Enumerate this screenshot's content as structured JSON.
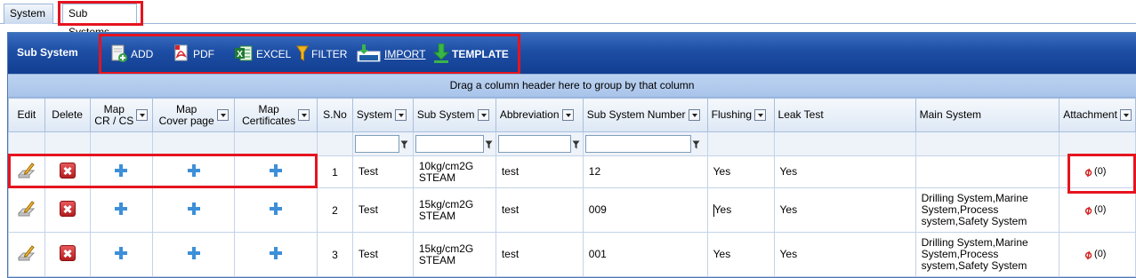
{
  "tabs": [
    {
      "label": "System",
      "active": false
    },
    {
      "label": "Sub Systems",
      "active": true
    }
  ],
  "toolbar": {
    "title": "Sub System",
    "add": "ADD",
    "pdf": "PDF",
    "excel": "EXCEL",
    "filter": "FILTER",
    "import": "IMPORT",
    "template": "TEMPLATE"
  },
  "group_hint": "Drag a column header here to group by that column",
  "columns": {
    "edit": "Edit",
    "delete": "Delete",
    "map_cr_1": "Map",
    "map_cr_2": "CR / CS",
    "map_cover_1": "Map",
    "map_cover_2": "Cover page",
    "map_cert_1": "Map",
    "map_cert_2": "Certificates",
    "sno": "S.No",
    "system": "System",
    "sub_system": "Sub System",
    "abbreviation": "Abbreviation",
    "sub_system_number": "Sub System Number",
    "flushing": "Flushing",
    "leak_test": "Leak Test",
    "main_system": "Main System",
    "attachment": "Attachment"
  },
  "rows": [
    {
      "sno": "1",
      "system": "Test",
      "sub_system_1": "10kg/cm2G",
      "sub_system_2": "STEAM",
      "abbreviation": "test",
      "number": "12",
      "flushing": "Yes",
      "leak_test": "Yes",
      "main_1": "",
      "main_2": "",
      "main_3": "",
      "attachment": "(0)"
    },
    {
      "sno": "2",
      "system": "Test",
      "sub_system_1": "15kg/cm2G",
      "sub_system_2": "STEAM",
      "abbreviation": "test",
      "number": "009",
      "flushing": "Yes",
      "leak_test": "Yes",
      "main_1": "Drilling System,Marine",
      "main_2": "System,Process",
      "main_3": "system,Safety System",
      "attachment": "(0)"
    },
    {
      "sno": "3",
      "system": "Test",
      "sub_system_1": "15kg/cm2G",
      "sub_system_2": "STEAM",
      "abbreviation": "test",
      "number": "001",
      "flushing": "Yes",
      "leak_test": "Yes",
      "main_1": "Drilling System,Marine",
      "main_2": "System,Process",
      "main_3": "system,Safety System",
      "attachment": "(0)"
    }
  ],
  "colors": {
    "toolbar_blue": "#1d4ea5",
    "highlight_red": "#e5141f",
    "plus_blue": "#3d8fd8",
    "delete_red": "#c62828"
  }
}
